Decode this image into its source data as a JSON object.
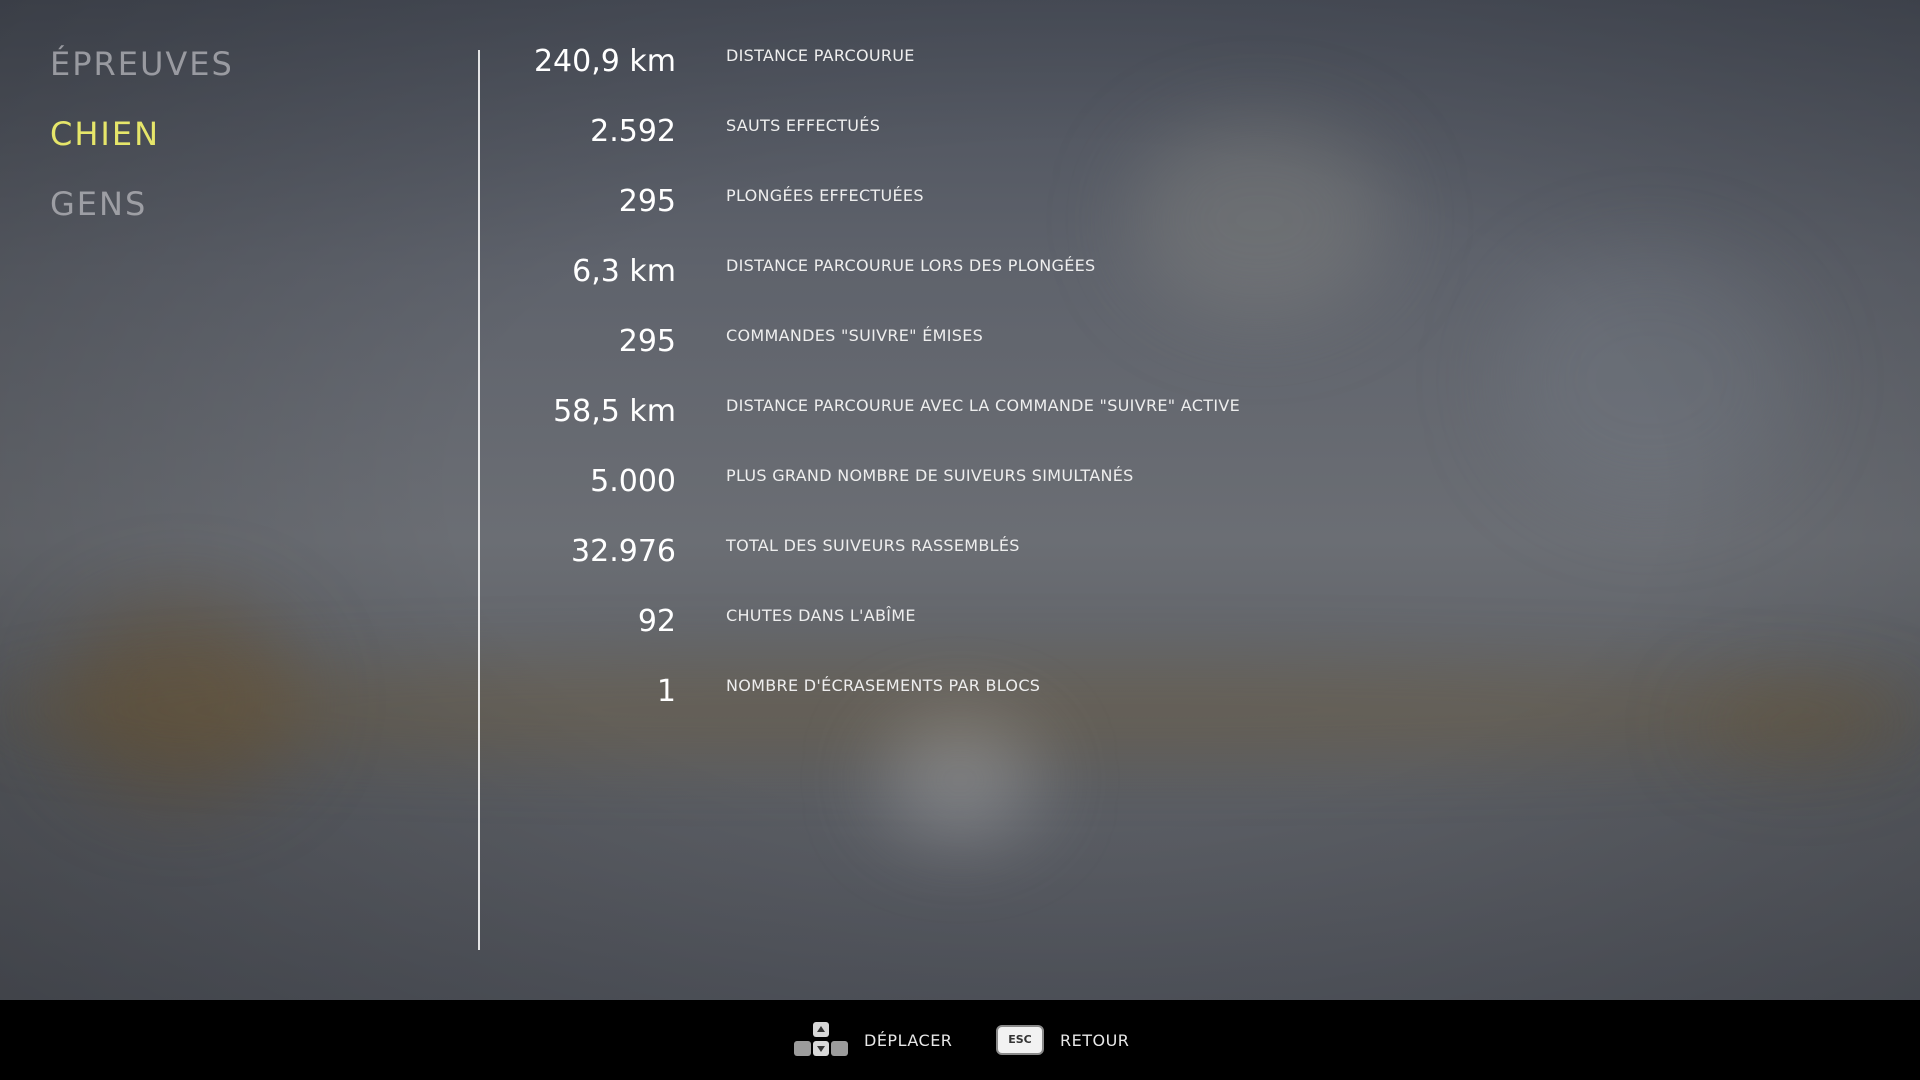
{
  "nav": {
    "items": [
      {
        "label": "ÉPREUVES",
        "active": false
      },
      {
        "label": "CHIEN",
        "active": true
      },
      {
        "label": "GENS",
        "active": false
      }
    ]
  },
  "stats": [
    {
      "value": "240,9 km",
      "label": "DISTANCE PARCOURUE"
    },
    {
      "value": "2.592",
      "label": "SAUTS EFFECTUÉS"
    },
    {
      "value": "295",
      "label": "PLONGÉES EFFECTUÉES"
    },
    {
      "value": "6,3 km",
      "label": "DISTANCE PARCOURUE LORS DES PLONGÉES"
    },
    {
      "value": "295",
      "label": "COMMANDES \"SUIVRE\" ÉMISES"
    },
    {
      "value": "58,5 km",
      "label": "DISTANCE PARCOURUE AVEC LA COMMANDE \"SUIVRE\" ACTIVE"
    },
    {
      "value": "5.000",
      "label": "PLUS GRAND NOMBRE DE SUIVEURS SIMULTANÉS"
    },
    {
      "value": "32.976",
      "label": "TOTAL DES SUIVEURS RASSEMBLÉS"
    },
    {
      "value": "92",
      "label": "CHUTES DANS L'ABÎME"
    },
    {
      "value": "1",
      "label": "NOMBRE D'ÉCRASEMENTS PAR BLOCS"
    }
  ],
  "footer": {
    "move_icon": "dpad-up-down-icon",
    "move_label": "DÉPLACER",
    "back_key": "ESC",
    "back_label": "RETOUR"
  },
  "colors": {
    "active": "#e6e66a",
    "inactive": "#c8c8cd",
    "footer_bg": "#000000"
  }
}
